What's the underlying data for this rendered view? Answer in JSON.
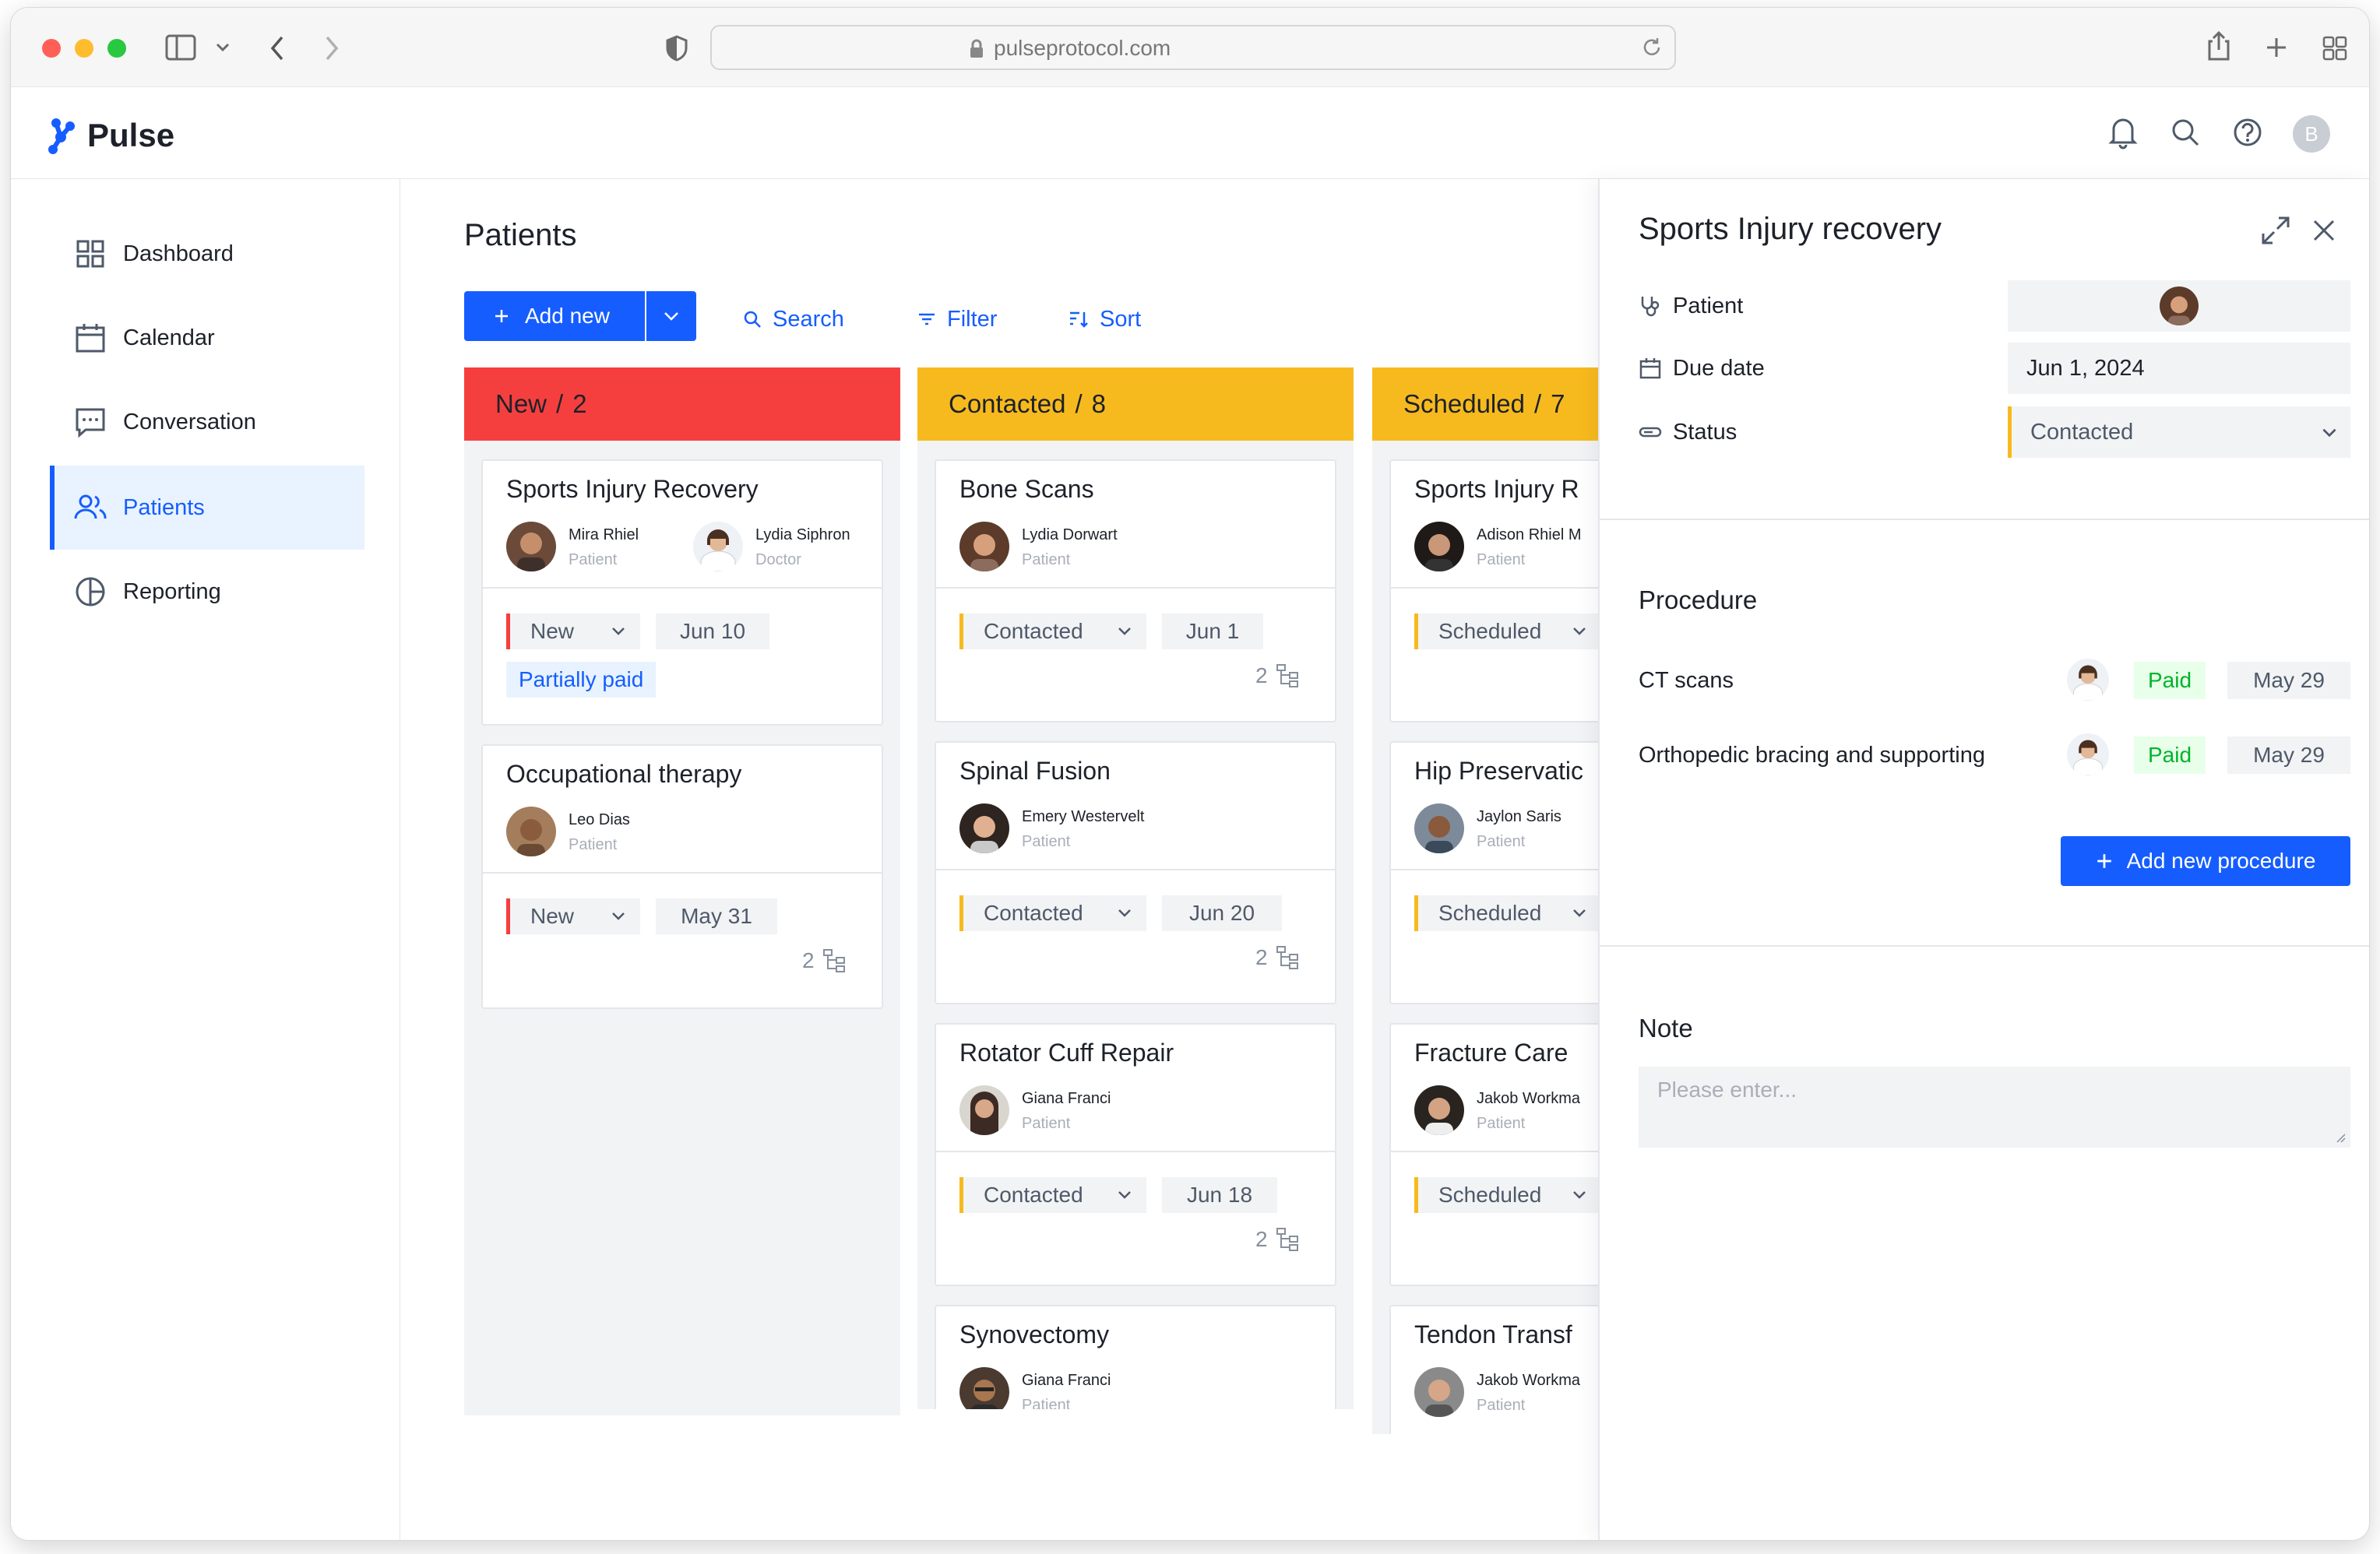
{
  "browser": {
    "url": "pulseprotocol.com"
  },
  "app": {
    "name": "Pulse",
    "user_initial": "B"
  },
  "sidebar": {
    "items": [
      {
        "label": "Dashboard"
      },
      {
        "label": "Calendar"
      },
      {
        "label": "Conversation"
      },
      {
        "label": "Patients"
      },
      {
        "label": "Reporting"
      }
    ],
    "active": "Patients"
  },
  "main": {
    "title": "Patients",
    "add_new": "Add new",
    "search": "Search",
    "filter": "Filter",
    "sort": "Sort"
  },
  "columns": [
    {
      "title": "New",
      "sep": "/",
      "count": "2",
      "color": "#f53f3f",
      "cards": [
        {
          "title": "Sports Injury Recovery",
          "people": [
            {
              "name": "Mira Rhiel",
              "role": "Patient"
            },
            {
              "name": "Lydia Siphron",
              "role": "Doctor"
            }
          ],
          "status": "New",
          "date": "Jun 10",
          "payment": "Partially paid"
        },
        {
          "title": "Occupational therapy",
          "people": [
            {
              "name": "Leo Dias",
              "role": "Patient"
            }
          ],
          "status": "New",
          "date": "May 31",
          "subtasks": "2"
        }
      ]
    },
    {
      "title": "Contacted",
      "sep": "/",
      "count": "8",
      "color": "#f7ba1e",
      "cards": [
        {
          "title": "Bone Scans",
          "people": [
            {
              "name": "Lydia Dorwart",
              "role": "Patient"
            }
          ],
          "status": "Contacted",
          "date": "Jun 1",
          "subtasks": "2"
        },
        {
          "title": "Spinal Fusion",
          "people": [
            {
              "name": "Emery Westervelt",
              "role": "Patient"
            }
          ],
          "status": "Contacted",
          "date": "Jun 20",
          "subtasks": "2"
        },
        {
          "title": "Rotator Cuff Repair",
          "people": [
            {
              "name": "Giana Franci",
              "role": "Patient"
            }
          ],
          "status": "Contacted",
          "date": "Jun 18",
          "subtasks": "2"
        },
        {
          "title": "Synovectomy",
          "people": [
            {
              "name": "Giana Franci",
              "role": "Patient"
            }
          ]
        }
      ]
    },
    {
      "title": "Scheduled",
      "sep": "/",
      "count": "7",
      "color": "#f7ba1e",
      "cards": [
        {
          "title": "Sports Injury R",
          "people": [
            {
              "name": "Adison Rhiel M",
              "role": "Patient"
            }
          ],
          "status": "Scheduled"
        },
        {
          "title": "Hip Preservatic",
          "people": [
            {
              "name": "Jaylon Saris",
              "role": "Patient"
            }
          ],
          "status": "Scheduled"
        },
        {
          "title": "Fracture Care",
          "people": [
            {
              "name": "Jakob Workma",
              "role": "Patient"
            }
          ],
          "status": "Scheduled"
        },
        {
          "title": "Tendon Transf",
          "people": [
            {
              "name": "Jakob Workma",
              "role": "Patient"
            }
          ]
        }
      ]
    }
  ],
  "panel": {
    "title": "Sports Injury recovery",
    "patient_label": "Patient",
    "due_label": "Due date",
    "due_value": "Jun 1, 2024",
    "status_label": "Status",
    "status_value": "Contacted",
    "procedure_title": "Procedure",
    "procedures": [
      {
        "name": "CT scans",
        "payment": "Paid",
        "date": "May 29"
      },
      {
        "name": "Orthopedic bracing and supporting",
        "payment": "Paid",
        "date": "May 29"
      }
    ],
    "add_procedure": "Add new procedure",
    "note_title": "Note",
    "note_placeholder": "Please enter..."
  },
  "colors": {
    "primary": "#165dff",
    "new": "#f53f3f",
    "contacted": "#f7ba1e",
    "paid": "#00b42a"
  }
}
